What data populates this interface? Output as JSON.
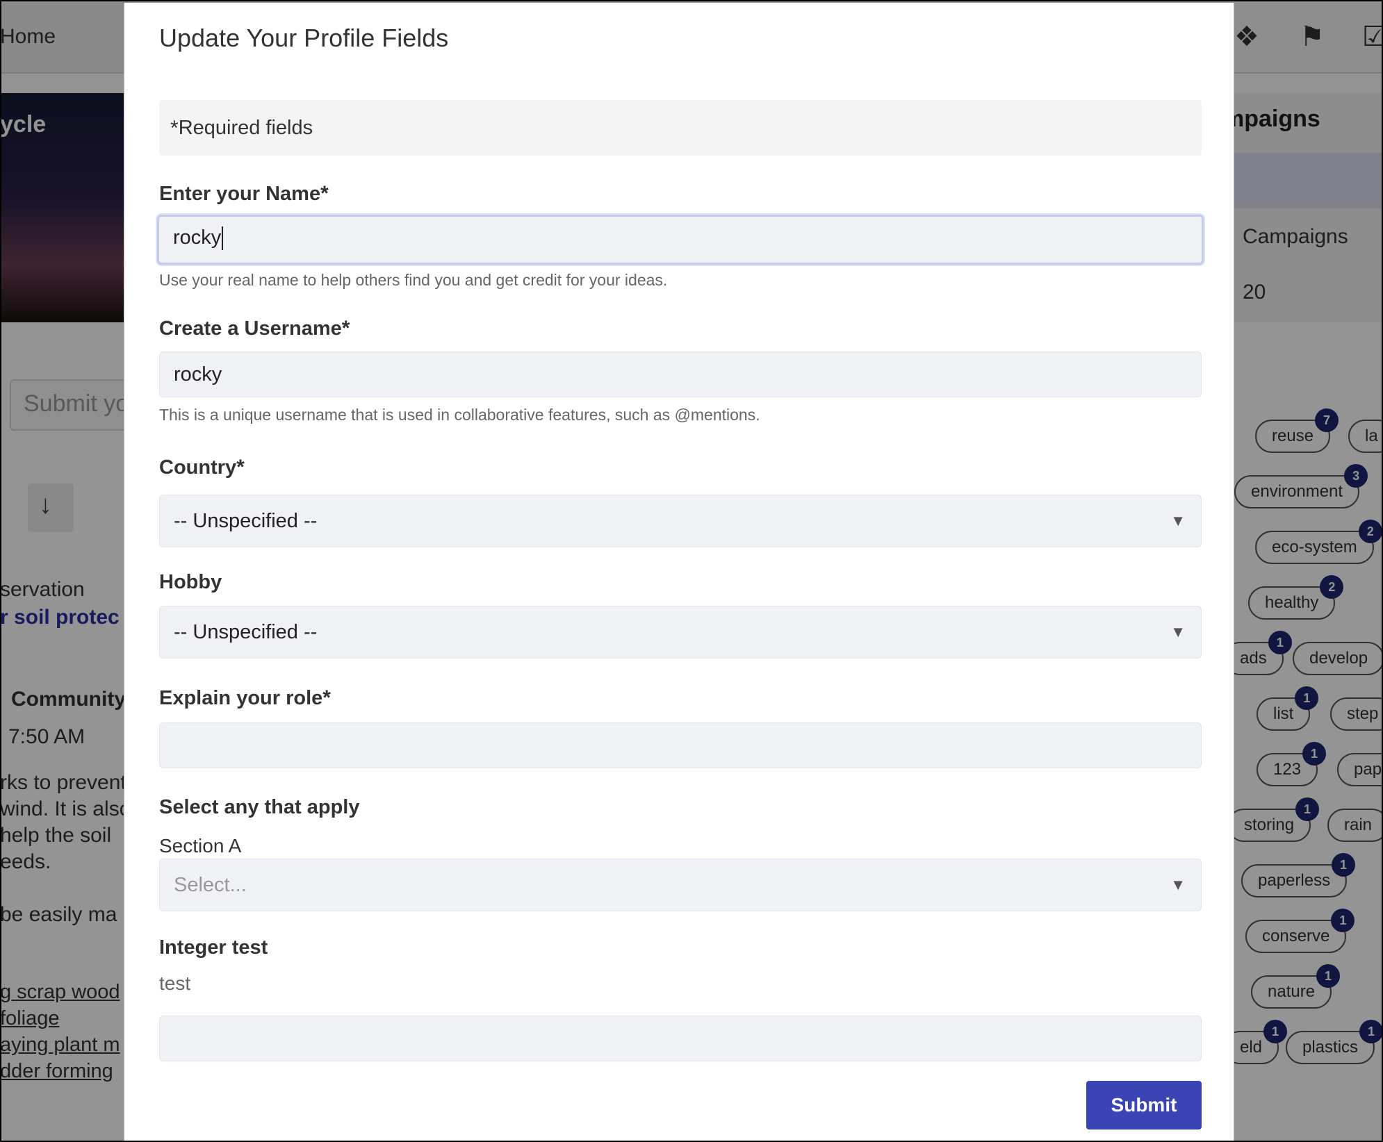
{
  "background": {
    "home_tab": "Home",
    "hero_title": "ycle",
    "submit_placeholder": "Submit yo",
    "vote_arrow": "↓",
    "category": "servation",
    "idea_title": "r soil protec",
    "author": "Community",
    "time": "7:50 AM",
    "body_lines": [
      "rks to prevent",
      "wind. It is also",
      "help the soil",
      "eeds."
    ],
    "body_line_extra": "be easily ma",
    "links": [
      "g scrap wood",
      "foliage",
      "aying plant m",
      "dder forming"
    ],
    "campaigns_title": "mpaigns",
    "campaigns_link": "Campaigns",
    "campaigns_count": "20",
    "tags": [
      {
        "label": "reuse",
        "count": "7"
      },
      {
        "label": "la",
        "count": ""
      },
      {
        "label": "environment",
        "count": "3"
      },
      {
        "label": "eco-system",
        "count": "2"
      },
      {
        "label": "healthy",
        "count": "2"
      },
      {
        "label": "ads",
        "count": "1"
      },
      {
        "label": "develop",
        "count": ""
      },
      {
        "label": "list",
        "count": "1"
      },
      {
        "label": "step",
        "count": ""
      },
      {
        "label": "123",
        "count": "1"
      },
      {
        "label": "pap",
        "count": ""
      },
      {
        "label": "storing",
        "count": "1"
      },
      {
        "label": "rain",
        "count": ""
      },
      {
        "label": "paperless",
        "count": "1"
      },
      {
        "label": "conserve",
        "count": "1"
      },
      {
        "label": "nature",
        "count": "1"
      },
      {
        "label": "eld",
        "count": "1"
      },
      {
        "label": "plastics",
        "count": "1"
      }
    ]
  },
  "modal": {
    "title": "Update Your Profile Fields",
    "required_star": "*",
    "required_note": "Required fields",
    "name": {
      "label": "Enter your Name",
      "req": "*",
      "value": "rocky",
      "help": "Use your real name to help others find you and get credit for your ideas."
    },
    "username": {
      "label": "Create a Username",
      "req": "*",
      "value": "rocky",
      "help": "This is a unique username that is used in collaborative features, such as @mentions."
    },
    "country": {
      "label": "Country",
      "req": "*",
      "value": "-- Unspecified --"
    },
    "hobby": {
      "label": "Hobby",
      "value": "-- Unspecified --"
    },
    "role": {
      "label": "Explain your role",
      "req": "*",
      "value": ""
    },
    "apply": {
      "label": "Select any that apply",
      "section": "Section A",
      "placeholder": "Select..."
    },
    "integer_test": {
      "label": "Integer test",
      "text": "test",
      "value": ""
    },
    "submit_label": "Submit"
  }
}
